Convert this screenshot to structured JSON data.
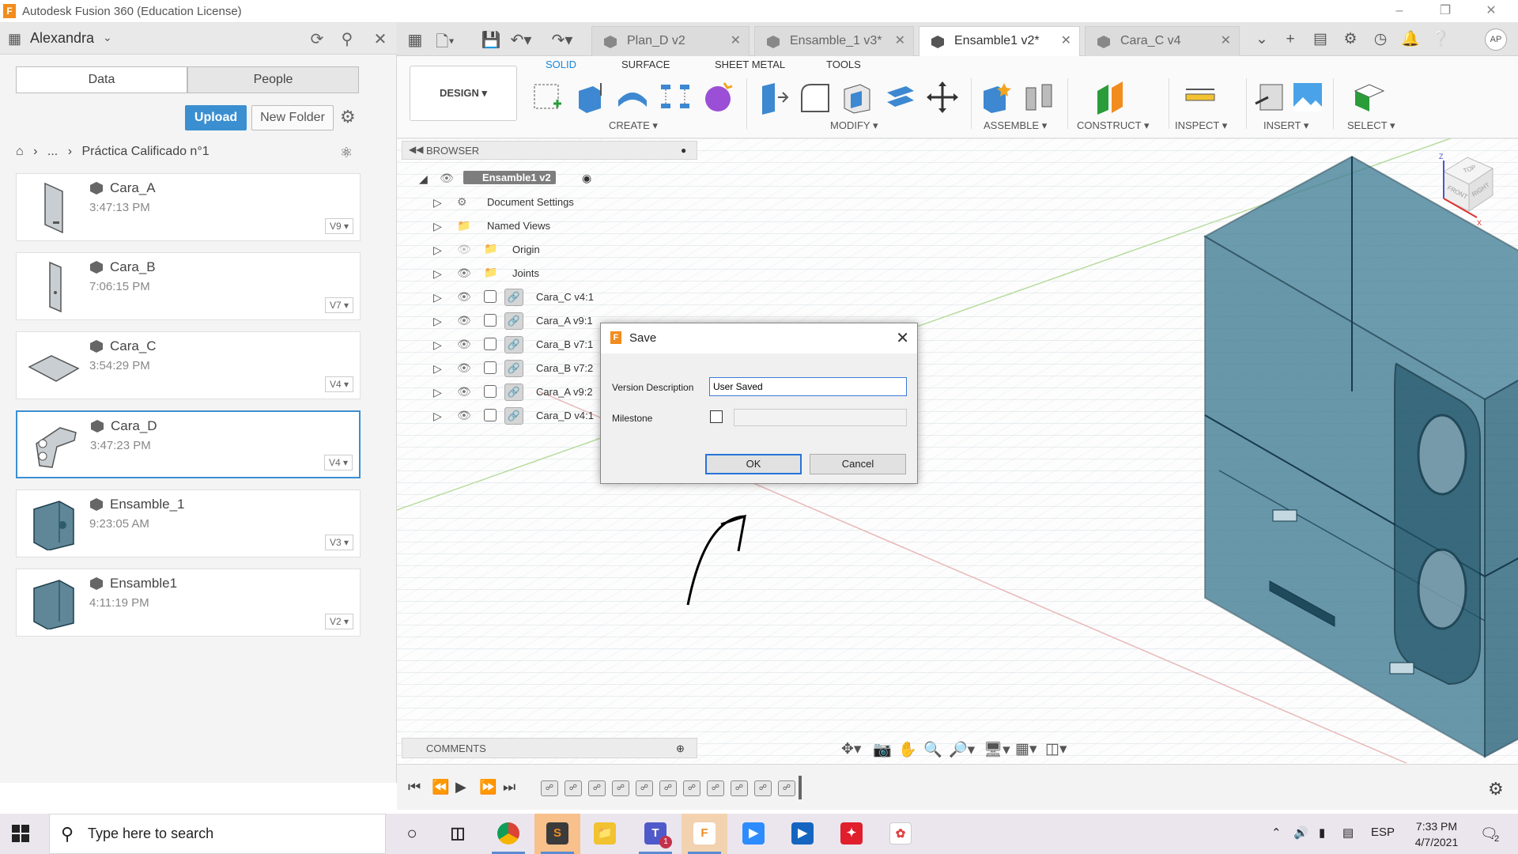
{
  "window": {
    "title": "Autodesk Fusion 360 (Education License)",
    "logo_letter": "F"
  },
  "data_panel": {
    "user": "Alexandra",
    "tabs": {
      "data": "Data",
      "people": "People"
    },
    "upload": "Upload",
    "new_folder": "New Folder",
    "breadcrumb": {
      "ellipsis": "...",
      "folder": "Práctica Calificado n°1"
    },
    "files": [
      {
        "name": "Cara_A",
        "time": "3:47:13 PM",
        "version": "V9"
      },
      {
        "name": "Cara_B",
        "time": "7:06:15 PM",
        "version": "V7"
      },
      {
        "name": "Cara_C",
        "time": "3:54:29 PM",
        "version": "V4"
      },
      {
        "name": "Cara_D",
        "time": "3:47:23 PM",
        "version": "V4"
      },
      {
        "name": "Ensamble_1",
        "time": "9:23:05 AM",
        "version": "V3"
      },
      {
        "name": "Ensamble1",
        "time": "4:11:19 PM",
        "version": "V2"
      }
    ]
  },
  "doc_tabs": [
    {
      "label": "Plan_D v2"
    },
    {
      "label": "Ensamble_1 v3*"
    },
    {
      "label": "Ensamble1 v2*"
    },
    {
      "label": "Cara_C v4"
    }
  ],
  "avatar_initials": "AP",
  "ribbon": {
    "workspace": "DESIGN",
    "tabs": [
      "SOLID",
      "SURFACE",
      "SHEET METAL",
      "TOOLS"
    ],
    "groups": [
      "CREATE",
      "MODIFY",
      "ASSEMBLE",
      "CONSTRUCT",
      "INSPECT",
      "INSERT",
      "SELECT"
    ]
  },
  "browser": {
    "title": "BROWSER",
    "root": "Ensamble1 v2",
    "nodes": [
      "Document Settings",
      "Named Views",
      "Origin",
      "Joints",
      "Cara_C v4:1",
      "Cara_A v9:1",
      "Cara_B v7:1",
      "Cara_B v7:2",
      "Cara_A v9:2",
      "Cara_D v4:1"
    ]
  },
  "comments": {
    "title": "COMMENTS"
  },
  "viewcube": {
    "top": "TOP",
    "front": "FRONT",
    "right": "RIGHT",
    "z": "Z",
    "x": "X"
  },
  "save_dialog": {
    "title": "Save",
    "version_label": "Version Description",
    "version_value": "User Saved",
    "milestone_label": "Milestone",
    "ok": "OK",
    "cancel": "Cancel"
  },
  "taskbar": {
    "search_placeholder": "Type here to search",
    "language": "ESP",
    "time": "7:33 PM",
    "date": "4/7/2021",
    "notification_count": "2",
    "teams_badge": "1"
  },
  "colors": {
    "accent": "#3b8fd1",
    "model_fill": "#2f6d85",
    "model_edge": "#163a4a",
    "grid": "#cdd6dc",
    "fusion_orange": "#f28c1e"
  }
}
